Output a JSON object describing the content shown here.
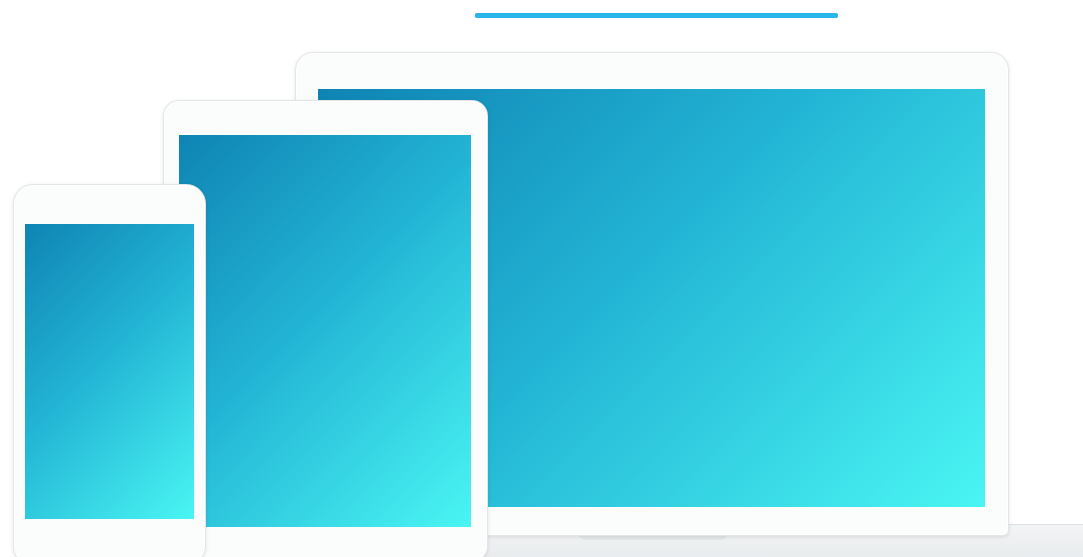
{
  "colors": {
    "accent_line": "#29b6ea",
    "screen_gradient_start": "#0f84b4",
    "screen_gradient_mid": "#22b3d4",
    "screen_gradient_end": "#4af5f3",
    "device_frame": "#fbfcfc"
  },
  "devices": [
    {
      "kind": "laptop"
    },
    {
      "kind": "tablet"
    },
    {
      "kind": "phone"
    }
  ]
}
